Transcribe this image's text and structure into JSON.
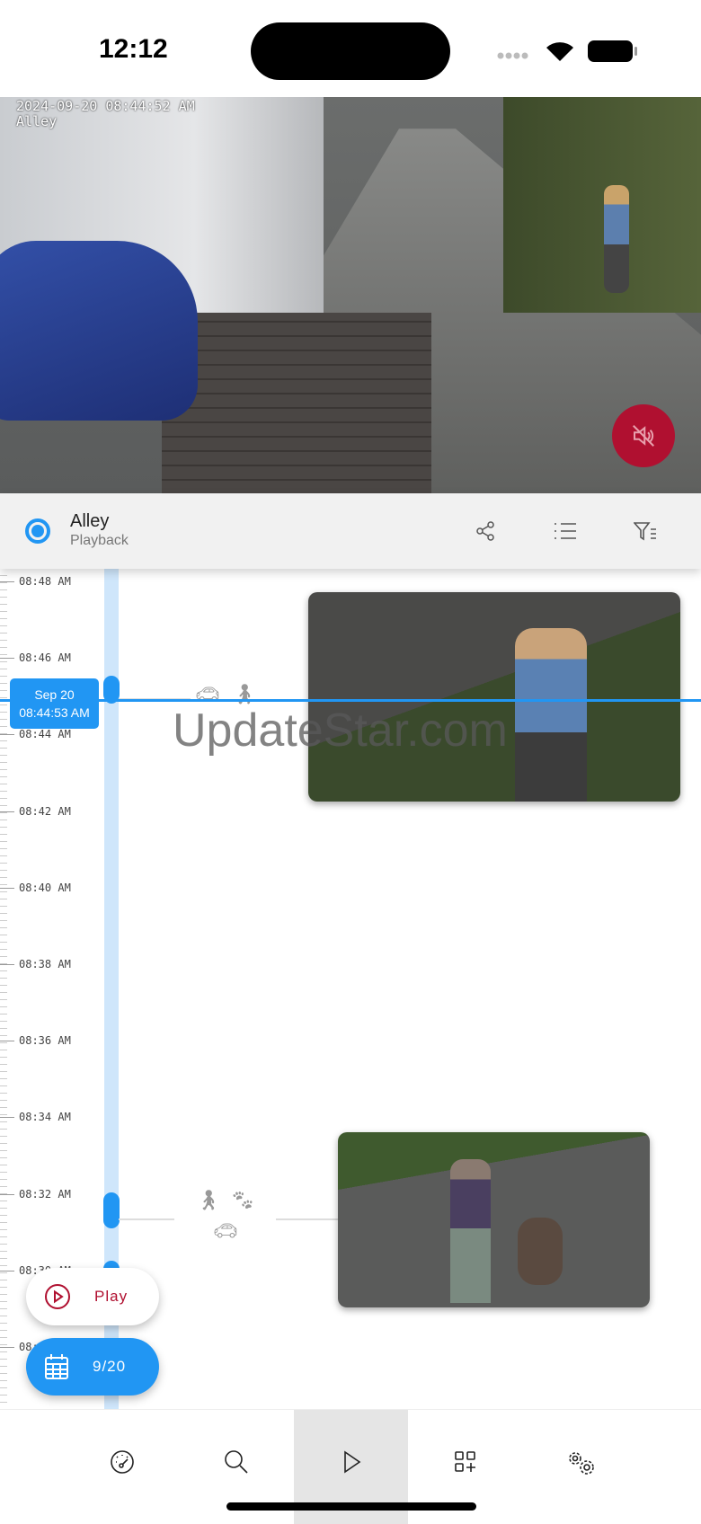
{
  "status_bar": {
    "time": "12:12"
  },
  "video": {
    "timestamp": "2024-09-20 08:44:52 AM",
    "camera_label": "Alley",
    "mute_icon": "speaker-muted-icon"
  },
  "header": {
    "title": "Alley",
    "subtitle": "Playback",
    "icons": [
      "share-icon",
      "list-icon",
      "filter-list-icon"
    ]
  },
  "timeline": {
    "ticks": [
      "08:48 AM",
      "08:46 AM",
      "08:44 AM",
      "08:42 AM",
      "08:40 AM",
      "08:38 AM",
      "08:36 AM",
      "08:34 AM",
      "08:32 AM",
      "08:30 AM",
      "08:28 AM"
    ],
    "current": {
      "date": "Sep 20",
      "time": "08:44:53 AM"
    },
    "events": [
      {
        "icons": [
          "car-icon",
          "person-walking-icon"
        ]
      },
      {
        "icons": [
          "person-walking-icon",
          "paw-icon",
          "car-icon"
        ]
      }
    ]
  },
  "watermark": "UpdateStar.com",
  "buttons": {
    "play": "Play",
    "date": "9/20"
  },
  "accent": "#2196f3",
  "alert": "#b01030",
  "nav": {
    "items": [
      "dashboard",
      "search",
      "playback",
      "add-widget",
      "settings"
    ],
    "active": "playback"
  }
}
